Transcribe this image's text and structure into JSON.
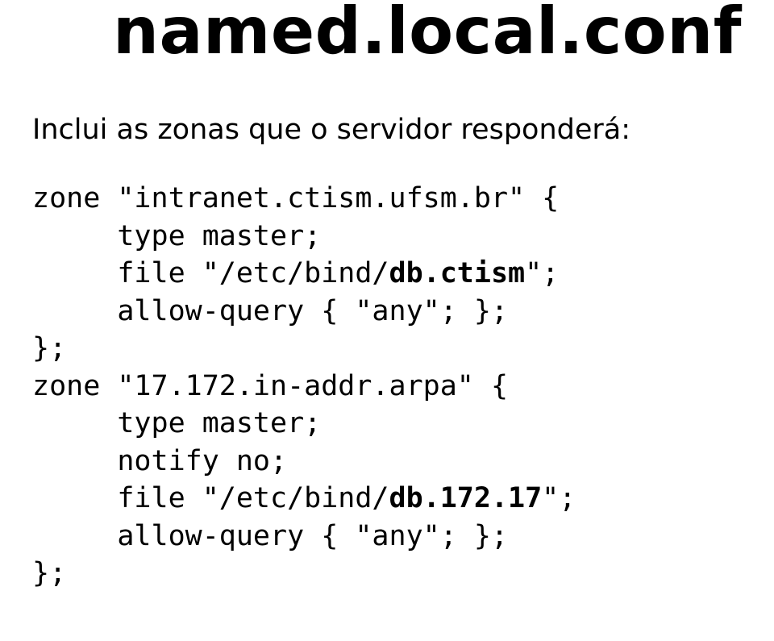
{
  "title": "named.local.conf",
  "intro": "Inclui as zonas que o servidor responderá:",
  "code": {
    "l01a": "zone \"intranet.ctism.ufsm.br\" {",
    "l02": "     type master;",
    "l03a": "     file \"/etc/bind/",
    "l03b": "db.ctism",
    "l03c": "\";",
    "l04": "     allow-query { \"any\"; };",
    "l05": "};",
    "l06": "zone \"17.172.in-addr.arpa\" {",
    "l07": "     type master;",
    "l08": "     notify no;",
    "l09a": "     file \"/etc/bind/",
    "l09b": "db.172.17",
    "l09c": "\";",
    "l10": "     allow-query { \"any\"; };",
    "l11": "};"
  }
}
